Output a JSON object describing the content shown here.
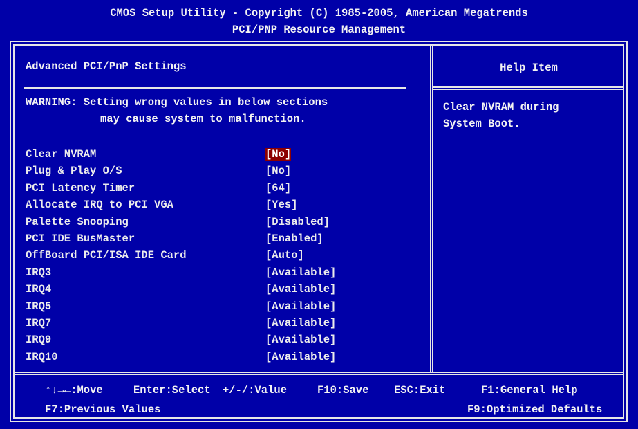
{
  "header": {
    "line1": "CMOS Setup Utility - Copyright (C) 1985-2005, American Megatrends",
    "line2": "PCI/PNP Resource Management"
  },
  "main": {
    "section_title": "Advanced PCI/PnP Settings",
    "warning_line1": "WARNING: Setting wrong values in below sections",
    "warning_line2": "may cause system to malfunction.",
    "settings": [
      {
        "label": "Clear NVRAM",
        "value": "[No]",
        "selected": true
      },
      {
        "label": "Plug & Play O/S",
        "value": "[No]"
      },
      {
        "label": "PCI Latency Timer",
        "value": "[64]"
      },
      {
        "label": "Allocate IRQ to PCI VGA",
        "value": "[Yes]"
      },
      {
        "label": "Palette Snooping",
        "value": "[Disabled]"
      },
      {
        "label": "PCI IDE BusMaster",
        "value": "[Enabled]"
      },
      {
        "label": "OffBoard PCI/ISA IDE Card",
        "value": "[Auto]"
      },
      {
        "label": "IRQ3",
        "value": "[Available]"
      },
      {
        "label": "IRQ4",
        "value": "[Available]"
      },
      {
        "label": "IRQ5",
        "value": "[Available]"
      },
      {
        "label": "IRQ7",
        "value": "[Available]"
      },
      {
        "label": "IRQ9",
        "value": "[Available]"
      },
      {
        "label": "IRQ10",
        "value": "[Available]"
      }
    ]
  },
  "help": {
    "title": "Help Item",
    "line1": "Clear NVRAM during",
    "line2": "System Boot."
  },
  "footer": {
    "move": "↑↓→←:Move",
    "select": "Enter:Select",
    "value": "+/-/:Value",
    "save": "F10:Save",
    "exit": "ESC:Exit",
    "general_help": "F1:General Help",
    "previous": "F7:Previous Values",
    "optimized": "F9:Optimized Defaults"
  },
  "colors": {
    "background": "#0000a8",
    "selected_value_bg": "#8c0000",
    "text": "#d0d0d0"
  }
}
